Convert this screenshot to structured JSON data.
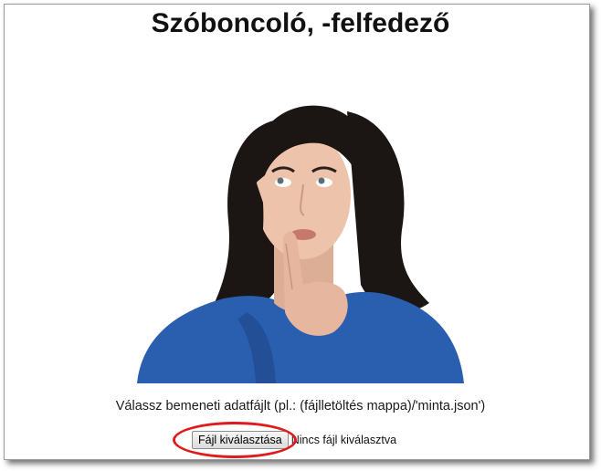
{
  "page": {
    "title": "Szóboncoló, -felfedező",
    "instruction": "Válassz bemeneti adatfájlt (pl.: (fájlletöltés mappa)/'minta.json')"
  },
  "file_input": {
    "button_label": "Fájl kiválasztása",
    "status_text": "Nincs fájl kiválasztva"
  },
  "colors": {
    "highlight": "#e01b1b",
    "shirt": "#2a5fb0",
    "hair": "#1b1514",
    "skin": "#edc3ab"
  }
}
